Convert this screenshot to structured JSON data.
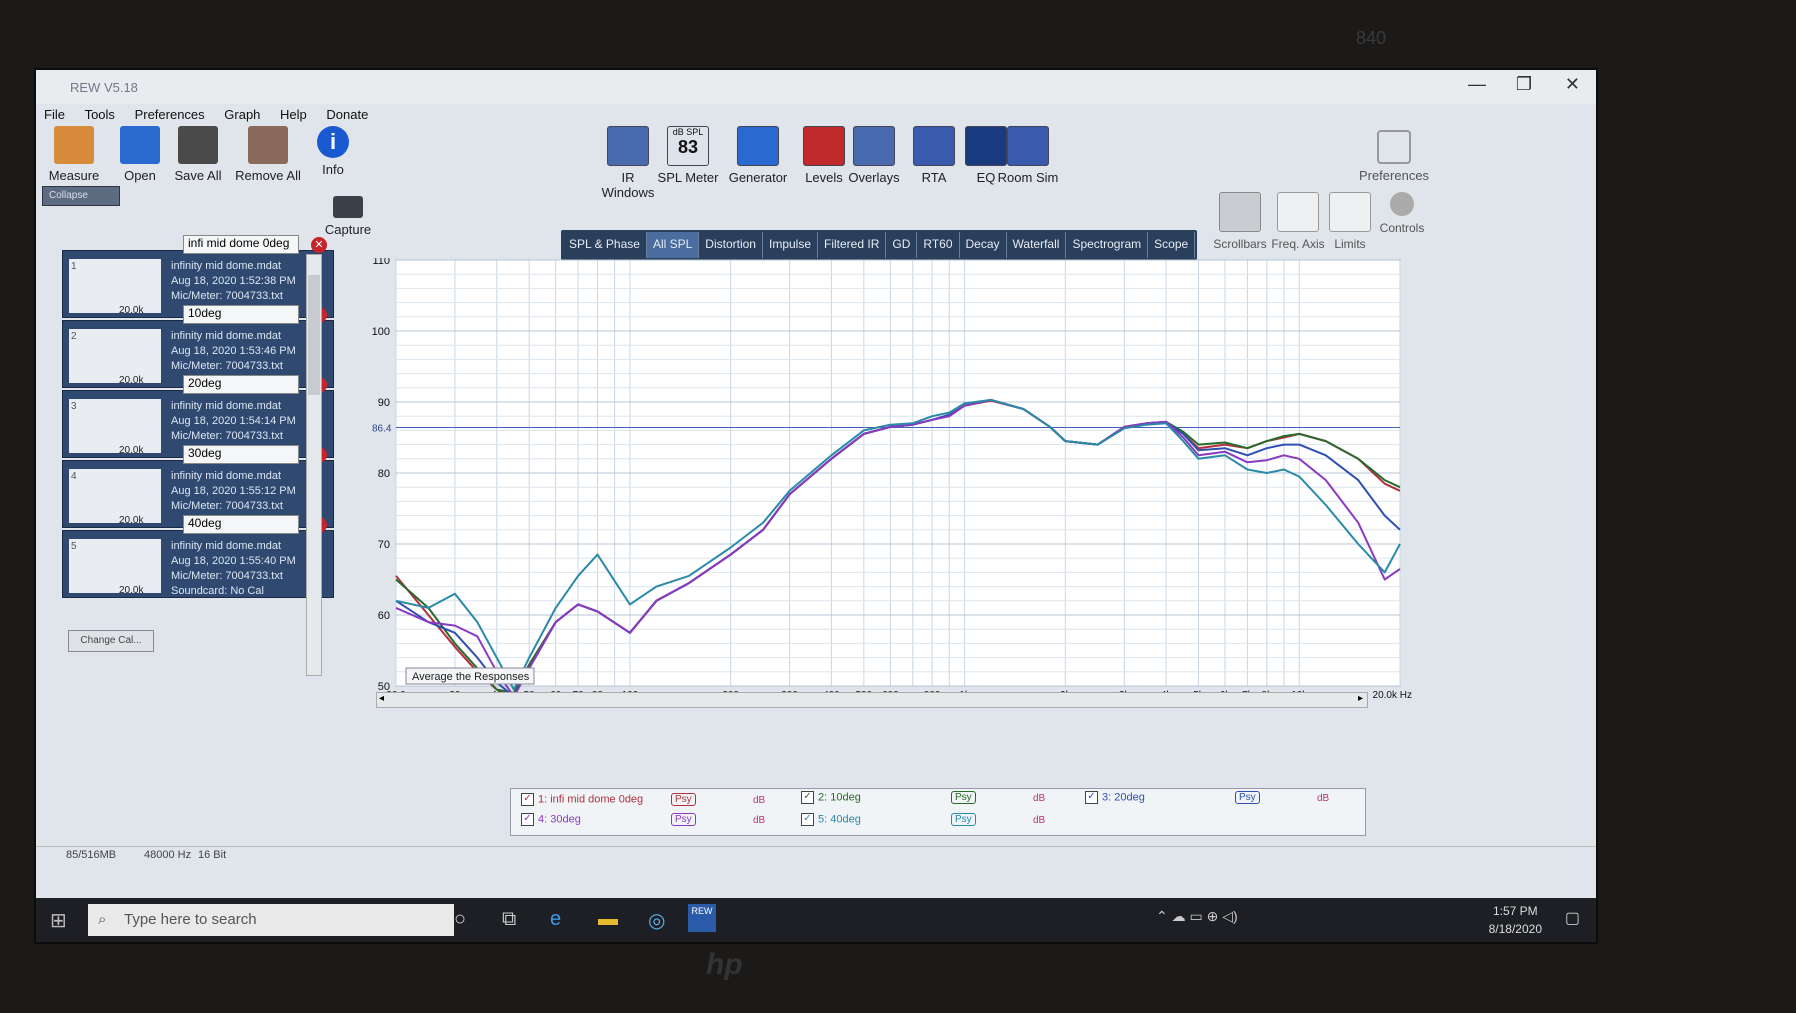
{
  "bezel": {
    "model": "840",
    "brand": "hp"
  },
  "window": {
    "title": "REW V5.18",
    "controls": [
      "—",
      "❐",
      "✕"
    ]
  },
  "menu": [
    "File",
    "Tools",
    "Preferences",
    "Graph",
    "Help",
    "Donate"
  ],
  "toolbar_left": [
    "Measure",
    "Open",
    "Save All",
    "Remove All",
    "Info"
  ],
  "toolbar_center": [
    {
      "label": "IR Windows",
      "icon": "ir-windows-icon"
    },
    {
      "label": "SPL Meter",
      "icon": "spl-meter-icon",
      "spl_header": "dB SPL",
      "spl_value": "83"
    },
    {
      "label": "Generator",
      "icon": "generator-icon"
    },
    {
      "label": "Levels",
      "icon": "levels-icon"
    },
    {
      "label": "Overlays",
      "icon": "overlays-icon"
    },
    {
      "label": "RTA",
      "icon": "rta-icon"
    },
    {
      "label": "EQ",
      "icon": "eq-icon"
    },
    {
      "label": "Room Sim",
      "icon": "room-sim-icon"
    }
  ],
  "preferences_label": "Preferences",
  "graph_controls": [
    "Scrollbars",
    "Freq. Axis",
    "Limits",
    "Controls"
  ],
  "capture_label": "Capture",
  "collapse_label": "Collapse",
  "change_cal_label": "Change Cal...",
  "tabs": [
    "SPL & Phase",
    "All SPL",
    "Distortion",
    "Impulse",
    "Filtered IR",
    "GD",
    "RT60",
    "Decay",
    "Waterfall",
    "Spectrogram",
    "Scope"
  ],
  "active_tab": "All SPL",
  "measurements": [
    {
      "num": "1",
      "name": "infi mid dome 0deg",
      "file": "infinity mid dome.mdat",
      "date": "Aug 18, 2020 1:52:38 PM",
      "mic": "Mic/Meter: 7004733.txt",
      "range": "20.0k"
    },
    {
      "num": "2",
      "name": "10deg",
      "file": "infinity mid dome.mdat",
      "date": "Aug 18, 2020 1:53:46 PM",
      "mic": "Mic/Meter: 7004733.txt",
      "range": "20.0k"
    },
    {
      "num": "3",
      "name": "20deg",
      "file": "infinity mid dome.mdat",
      "date": "Aug 18, 2020 1:54:14 PM",
      "mic": "Mic/Meter: 7004733.txt",
      "range": "20.0k"
    },
    {
      "num": "4",
      "name": "30deg",
      "file": "infinity mid dome.mdat",
      "date": "Aug 18, 2020 1:55:12 PM",
      "mic": "Mic/Meter: 7004733.txt",
      "range": "20.0k"
    },
    {
      "num": "5",
      "name": "40deg",
      "file": "infinity mid dome.mdat",
      "date": "Aug 18, 2020 1:55:40 PM",
      "mic": "Mic/Meter: 7004733.txt",
      "range": "20.0k",
      "soundcard": "Soundcard: No Cal"
    }
  ],
  "chart_data": {
    "type": "line",
    "ylabel": "dB",
    "xlabel": "Hz",
    "ylim": [
      50,
      110
    ],
    "xlim": [
      20,
      20000
    ],
    "x_scale": "log",
    "y_ticks": [
      "50",
      "60",
      "70",
      "80",
      "90",
      "100",
      "110"
    ],
    "x_ticks": [
      "20.0",
      "30",
      "40",
      "50",
      "60",
      "70",
      "80",
      "100",
      "200",
      "300",
      "400",
      "500",
      "600",
      "800",
      "1k",
      "2k",
      "3k",
      "4k",
      "5k",
      "6k",
      "7k",
      "8k",
      "10k",
      "20.0k Hz"
    ],
    "x_tick_values": [
      20,
      30,
      40,
      50,
      60,
      70,
      80,
      100,
      200,
      300,
      400,
      500,
      600,
      800,
      1000,
      2000,
      3000,
      4000,
      5000,
      6000,
      7000,
      8000,
      10000,
      20000
    ],
    "cursor_value": "86.4",
    "annotation": "Average the Responses",
    "grid": true,
    "x": [
      20,
      25,
      30,
      35,
      40,
      45,
      50,
      60,
      70,
      80,
      100,
      120,
      150,
      200,
      250,
      300,
      400,
      500,
      600,
      700,
      800,
      900,
      1000,
      1200,
      1500,
      1800,
      2000,
      2500,
      3000,
      3500,
      4000,
      4500,
      5000,
      6000,
      7000,
      8000,
      9000,
      10000,
      12000,
      15000,
      18000,
      20000
    ],
    "series": [
      {
        "name": "1: infi mid dome 0deg",
        "color": "#b03040",
        "values": [
          65.5,
          60,
          55.5,
          52,
          49.5,
          49,
          53,
          59,
          61.5,
          60.5,
          57.5,
          62,
          64.5,
          68.5,
          72,
          77,
          82,
          85.5,
          86.5,
          86.8,
          87.5,
          88,
          89.5,
          90.2,
          89,
          86.5,
          84.5,
          84,
          86.5,
          87,
          87.2,
          85.5,
          83.5,
          84,
          83.5,
          84.5,
          85,
          85.5,
          84.5,
          82,
          78.5,
          77.5
        ]
      },
      {
        "name": "2: 10deg",
        "color": "#2a6a2a",
        "values": [
          65,
          61,
          56,
          52.5,
          49.5,
          49,
          53,
          59,
          61.5,
          60.5,
          57.5,
          62,
          64.5,
          68.5,
          72,
          77,
          82,
          85.5,
          86.5,
          86.8,
          87.5,
          88.2,
          89.5,
          90.3,
          89,
          86.5,
          84.5,
          84,
          86.5,
          87,
          87.2,
          85.8,
          84,
          84.3,
          83.5,
          84.5,
          85.2,
          85.5,
          84.5,
          82,
          79,
          78
        ]
      },
      {
        "name": "3: 20deg",
        "color": "#3050b0",
        "values": [
          62,
          59,
          57.5,
          54,
          50.5,
          48.5,
          52.5,
          59,
          61.5,
          60.5,
          57.5,
          62,
          64.5,
          68.5,
          72,
          77,
          82,
          85.5,
          86.5,
          86.8,
          87.5,
          88.2,
          89.5,
          90.3,
          89,
          86.5,
          84.5,
          84,
          86.5,
          87,
          87.2,
          85.5,
          83.2,
          83.5,
          82.5,
          83.5,
          84,
          84,
          82.5,
          79,
          74,
          72
        ]
      },
      {
        "name": "4: 30deg",
        "color": "#8a3ac0",
        "values": [
          61,
          59,
          58.5,
          57,
          52,
          48.5,
          52.5,
          59,
          61.5,
          60.5,
          57.5,
          62,
          64.5,
          68.5,
          72,
          77,
          82,
          85.5,
          86.5,
          86.8,
          87.5,
          88,
          89.5,
          90.3,
          89,
          86.5,
          84.5,
          84,
          86.5,
          87,
          87.2,
          85,
          82.5,
          83,
          81.5,
          81.8,
          82.5,
          82,
          79,
          73,
          65,
          66.5
        ]
      },
      {
        "name": "5: 40deg",
        "color": "#2a8aa8",
        "values": [
          62,
          61,
          63,
          59,
          54,
          49.5,
          54,
          61,
          65.5,
          68.5,
          61.5,
          64,
          65.5,
          69.5,
          73,
          77.5,
          82.5,
          86,
          86.8,
          87,
          88,
          88.5,
          89.8,
          90.3,
          89,
          86.5,
          84.5,
          84,
          86.3,
          86.8,
          87,
          84.5,
          82,
          82.5,
          80.5,
          80,
          80.5,
          79.5,
          75.5,
          70,
          66,
          70
        ]
      }
    ]
  },
  "legend": [
    {
      "label": "1: infi mid dome 0deg",
      "psy": "Psy",
      "db": "dB",
      "color": "#b03040"
    },
    {
      "label": "2: 10deg",
      "psy": "Psy",
      "db": "dB",
      "color": "#2a6a2a"
    },
    {
      "label": "3: 20deg",
      "psy": "Psy",
      "db": "dB",
      "color": "#3050b0"
    },
    {
      "label": "4: 30deg",
      "psy": "Psy",
      "db": "dB",
      "color": "#8a3ac0"
    },
    {
      "label": "5: 40deg",
      "psy": "Psy",
      "db": "dB",
      "color": "#2a8aa8"
    }
  ],
  "status": {
    "memory": "85/516MB",
    "rate": "48000 Hz",
    "bits": "16 Bit"
  },
  "taskbar": {
    "search_placeholder": "Type here to search",
    "time": "1:57 PM",
    "date": "8/18/2020",
    "rew_label": "REW"
  }
}
